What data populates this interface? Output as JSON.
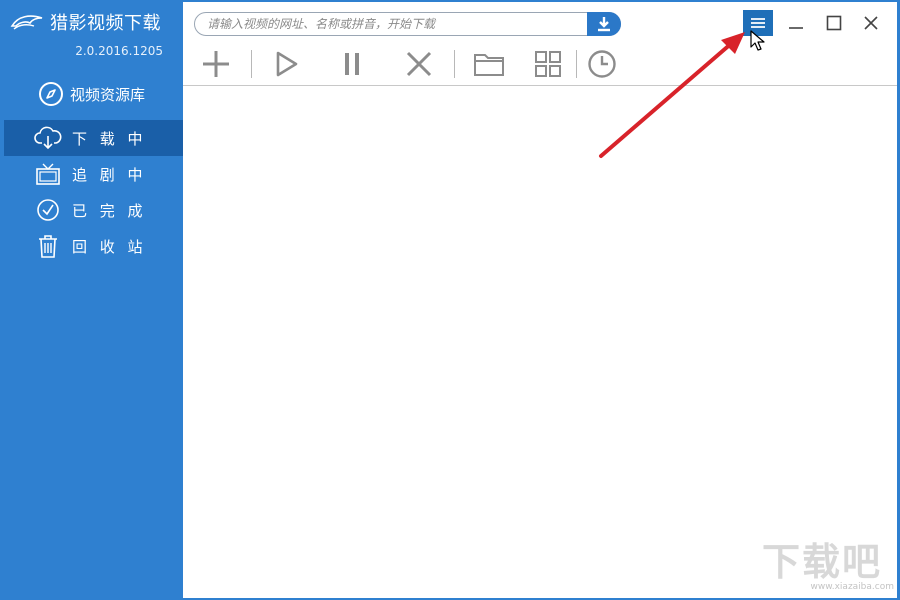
{
  "app": {
    "title": "猎影视频下载",
    "version": "2.0.2016.1205"
  },
  "sidebar": {
    "library_label": "视频资源库",
    "items": [
      {
        "label": "下 载 中",
        "icon": "cloud-download-icon",
        "active": true
      },
      {
        "label": "追 剧 中",
        "icon": "tv-icon",
        "active": false
      },
      {
        "label": "已 完 成",
        "icon": "check-circle-icon",
        "active": false
      },
      {
        "label": "回 收 站",
        "icon": "trash-icon",
        "active": false
      }
    ]
  },
  "search": {
    "placeholder": "请输入视频的网址、名称或拼音，开始下载",
    "value": ""
  },
  "toolbar": {
    "tools": [
      "add-icon",
      "play-icon",
      "pause-icon",
      "delete-icon",
      "folder-icon",
      "grid-icon",
      "clock-icon"
    ]
  },
  "colors": {
    "sidebar_bg": "#2f80d0",
    "active_item_bg": "#1a5fa8",
    "accent": "#2b78c8",
    "icon_gray": "#8c8c8c",
    "annotation_arrow": "#d8232a"
  },
  "watermark": {
    "text": "下载吧",
    "url": "www.xiazaiba.com"
  }
}
